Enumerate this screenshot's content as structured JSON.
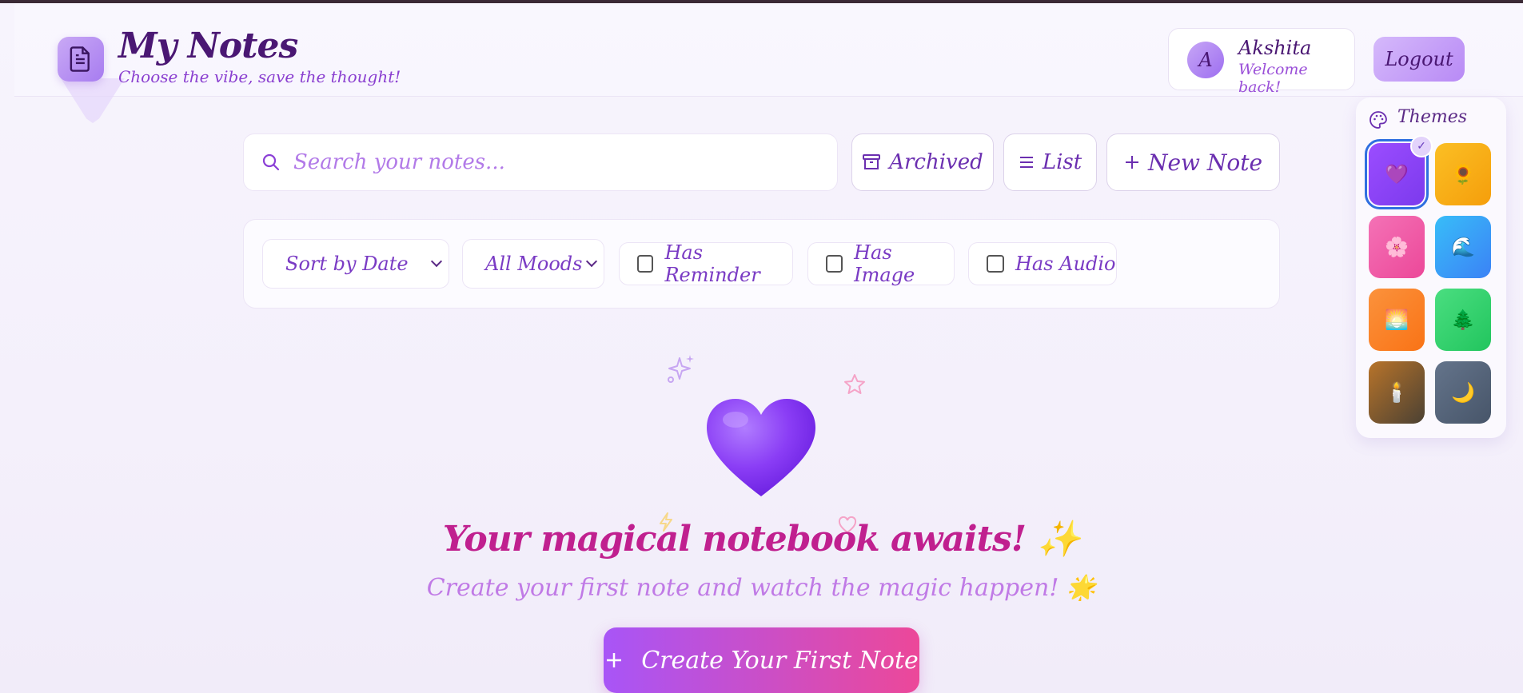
{
  "app": {
    "title": "My Notes",
    "subtitle": "Choose the vibe, save the thought!"
  },
  "user": {
    "initial": "A",
    "name": "Akshita",
    "welcome": "Welcome back!"
  },
  "header": {
    "logout_label": "Logout"
  },
  "toolbar": {
    "search_placeholder": "Search your notes...",
    "archived_label": "Archived",
    "list_label": "List",
    "new_note_label": "New Note"
  },
  "filters": {
    "sort_selected": "Sort by Date",
    "mood_selected": "All Moods",
    "has_reminder": "Has Reminder",
    "has_image": "Has Image",
    "has_audio": "Has Audio"
  },
  "themes": {
    "title": "Themes",
    "items": [
      {
        "emoji": "💜",
        "selected": true,
        "colors": [
          "#9b4dff",
          "#7c3aed"
        ]
      },
      {
        "emoji": "🌻",
        "selected": false,
        "colors": [
          "#fbbf24",
          "#f59e0b"
        ]
      },
      {
        "emoji": "🌸",
        "selected": false,
        "colors": [
          "#f472b6",
          "#ec4899"
        ]
      },
      {
        "emoji": "🌊",
        "selected": false,
        "colors": [
          "#38bdf8",
          "#3b82f6"
        ]
      },
      {
        "emoji": "🌅",
        "selected": false,
        "colors": [
          "#fb923c",
          "#f97316"
        ]
      },
      {
        "emoji": "🌲",
        "selected": false,
        "colors": [
          "#4ade80",
          "#22c55e"
        ]
      },
      {
        "emoji": "🕯️",
        "selected": false,
        "colors": [
          "#b8742a",
          "#4b4133"
        ]
      },
      {
        "emoji": "🌙",
        "selected": false,
        "colors": [
          "#64748b",
          "#475569"
        ]
      }
    ]
  },
  "empty_state": {
    "title": "Your magical notebook awaits! ✨",
    "subtitle": "Create your first note and watch the magic happen! 🌟",
    "cta_label": "Create Your First Note"
  },
  "colors": {
    "accent": "#a855f7",
    "accent_pink": "#ec4899",
    "title_pink": "#c0208f",
    "dark_purple": "#4a1773"
  }
}
